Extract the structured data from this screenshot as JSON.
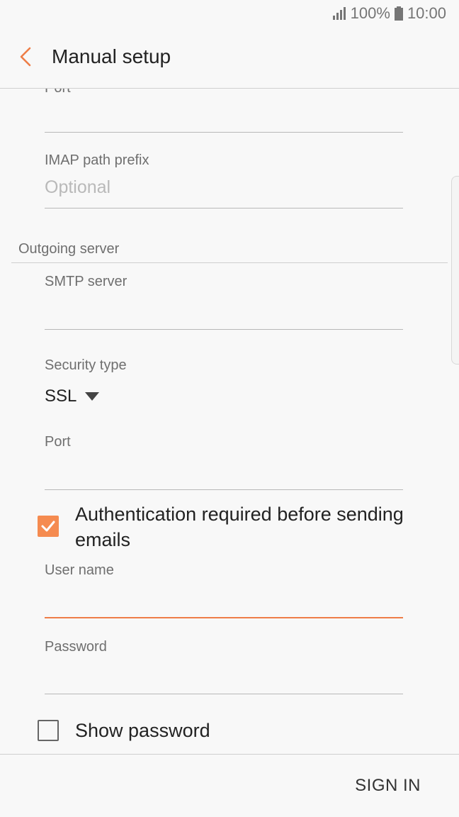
{
  "status_bar": {
    "battery": "100%",
    "time": "10:00"
  },
  "header": {
    "title": "Manual setup"
  },
  "form": {
    "port_top_label": "Port",
    "imap_prefix": {
      "label": "IMAP path prefix",
      "placeholder": "Optional"
    },
    "outgoing_section": "Outgoing server",
    "smtp_server": {
      "label": "SMTP server"
    },
    "security_type": {
      "label": "Security type",
      "value": "SSL"
    },
    "port": {
      "label": "Port"
    },
    "auth_required": {
      "label_line1": "Authentication required before sending",
      "label_line2": "emails",
      "checked": true
    },
    "user_name": {
      "label": "User name"
    },
    "password": {
      "label": "Password"
    },
    "show_password": {
      "label": "Show password",
      "checked": false
    }
  },
  "footer": {
    "sign_in": "SIGN IN"
  },
  "colors": {
    "accent": "#ee7d47",
    "checkbox": "#f58b50"
  }
}
